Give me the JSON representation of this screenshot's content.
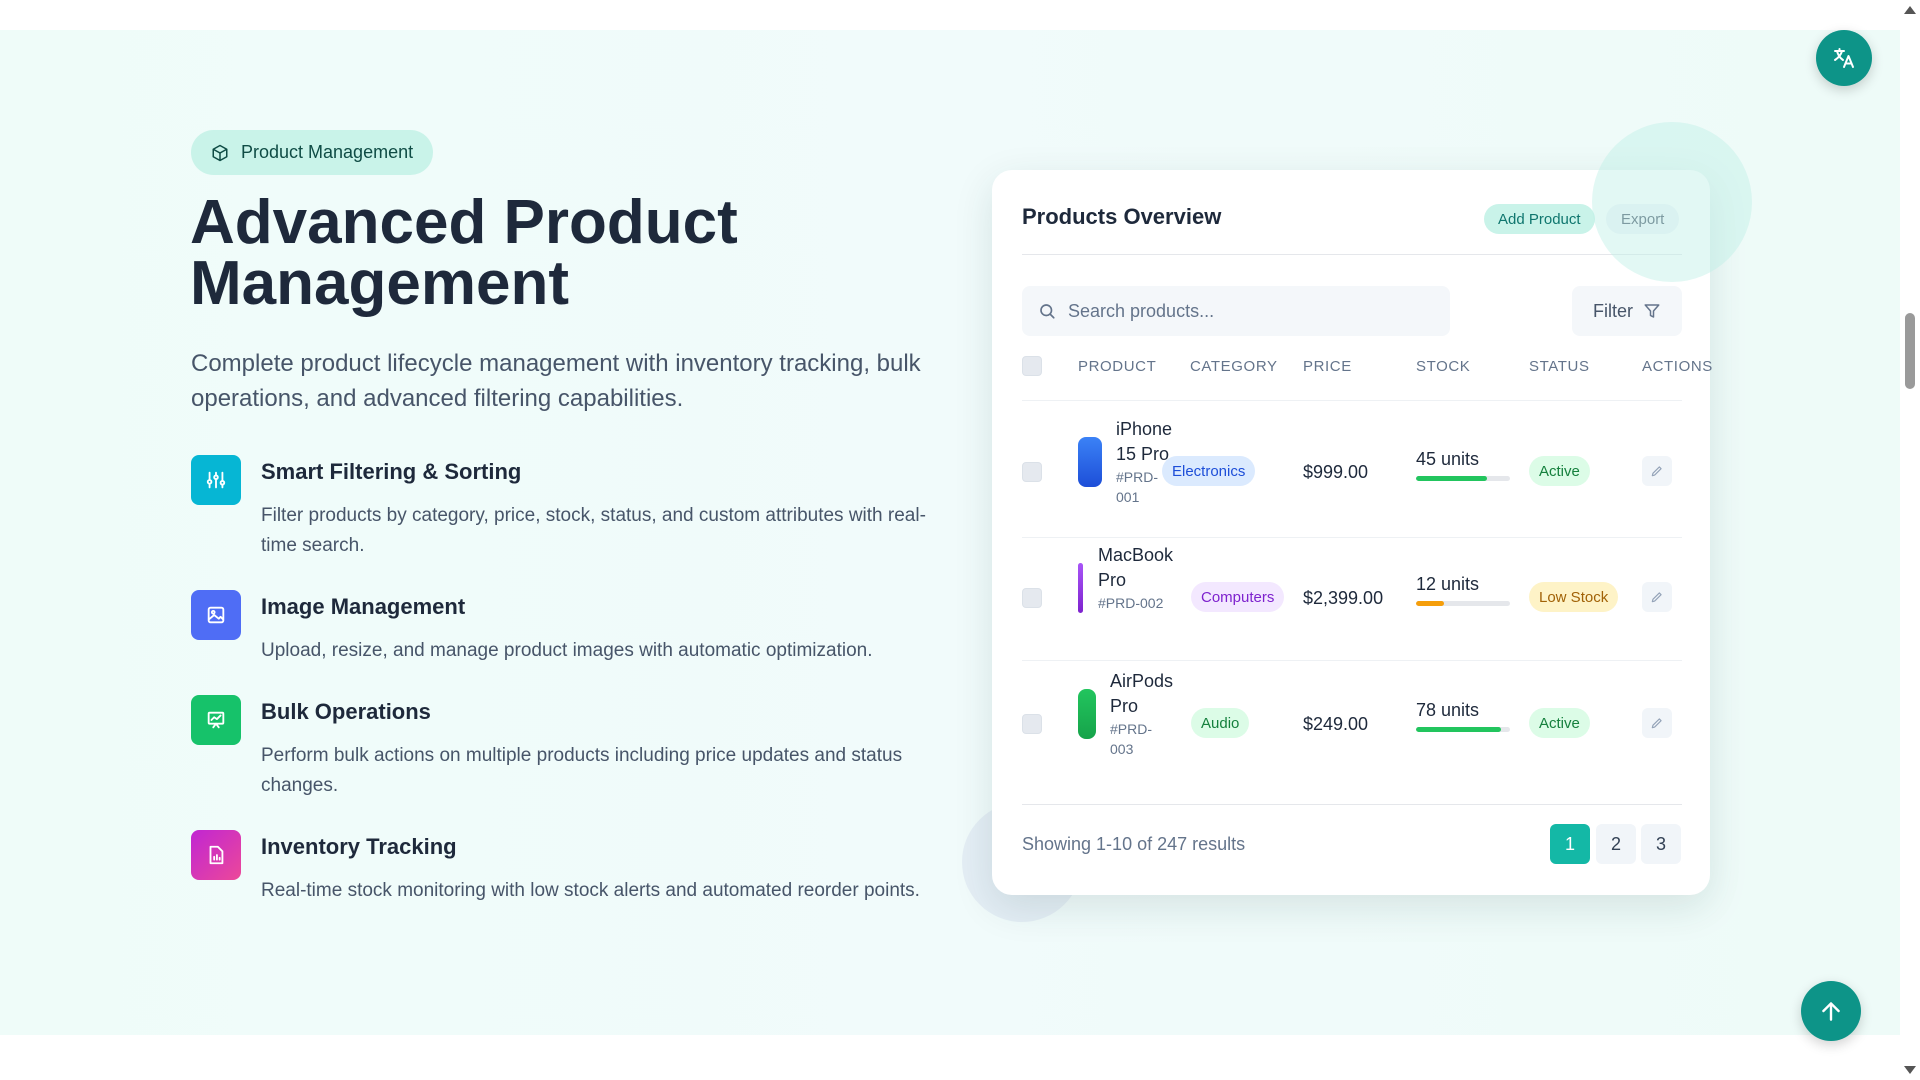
{
  "badge": {
    "label": "Product Management",
    "icon": "box-icon"
  },
  "hero": {
    "title": "Advanced Product Management",
    "subtitle": "Complete product lifecycle management with inventory tracking, bulk operations, and advanced filtering capabilities."
  },
  "features": [
    {
      "title": "Smart Filtering & Sorting",
      "desc": "Filter products by category, price, stock, status, and custom attributes with real-time search.",
      "icon": "sliders-icon",
      "color": "#06b6d4"
    },
    {
      "title": "Image Management",
      "desc": "Upload, resize, and manage product images with automatic optimization.",
      "icon": "image-icon",
      "color": "#4f6df5"
    },
    {
      "title": "Bulk Operations",
      "desc": "Perform bulk actions on multiple products including price updates and status changes.",
      "icon": "presentation-chart-icon",
      "color": "#16c26a"
    },
    {
      "title": "Inventory Tracking",
      "desc": "Real-time stock monitoring with low stock alerts and automated reorder points.",
      "icon": "file-chart-icon",
      "color": "#d946ef"
    }
  ],
  "card": {
    "title": "Products Overview",
    "add_label": "Add Product",
    "export_label": "Export",
    "search_placeholder": "Search products...",
    "filter_label": "Filter",
    "columns": [
      "PRODUCT",
      "CATEGORY",
      "PRICE",
      "STOCK",
      "STATUS",
      "ACTIONS"
    ],
    "rows": [
      {
        "name": "iPhone 15 Pro",
        "sku": "#PRD-001",
        "category": "Electronics",
        "price": "$999.00",
        "stock": "45 units",
        "stock_pct": 75,
        "status": "Active"
      },
      {
        "name": "MacBook Pro",
        "sku": "#PRD-002",
        "category": "Computers",
        "price": "$2,399.00",
        "stock": "12 units",
        "stock_pct": 30,
        "status": "Low Stock"
      },
      {
        "name": "AirPods Pro",
        "sku": "#PRD-003",
        "category": "Audio",
        "price": "$249.00",
        "stock": "78 units",
        "stock_pct": 90,
        "status": "Active"
      }
    ],
    "showing": "Showing 1-10 of 247 results",
    "pages": [
      "1",
      "2",
      "3"
    ],
    "current_page": "1"
  },
  "colors": {
    "accent": "#14b8a6",
    "active_green": "#22c55e",
    "low_stock_amber": "#f59e0b"
  },
  "fabs": {
    "translate_icon": "translate-icon",
    "top_icon": "arrow-up-icon"
  }
}
